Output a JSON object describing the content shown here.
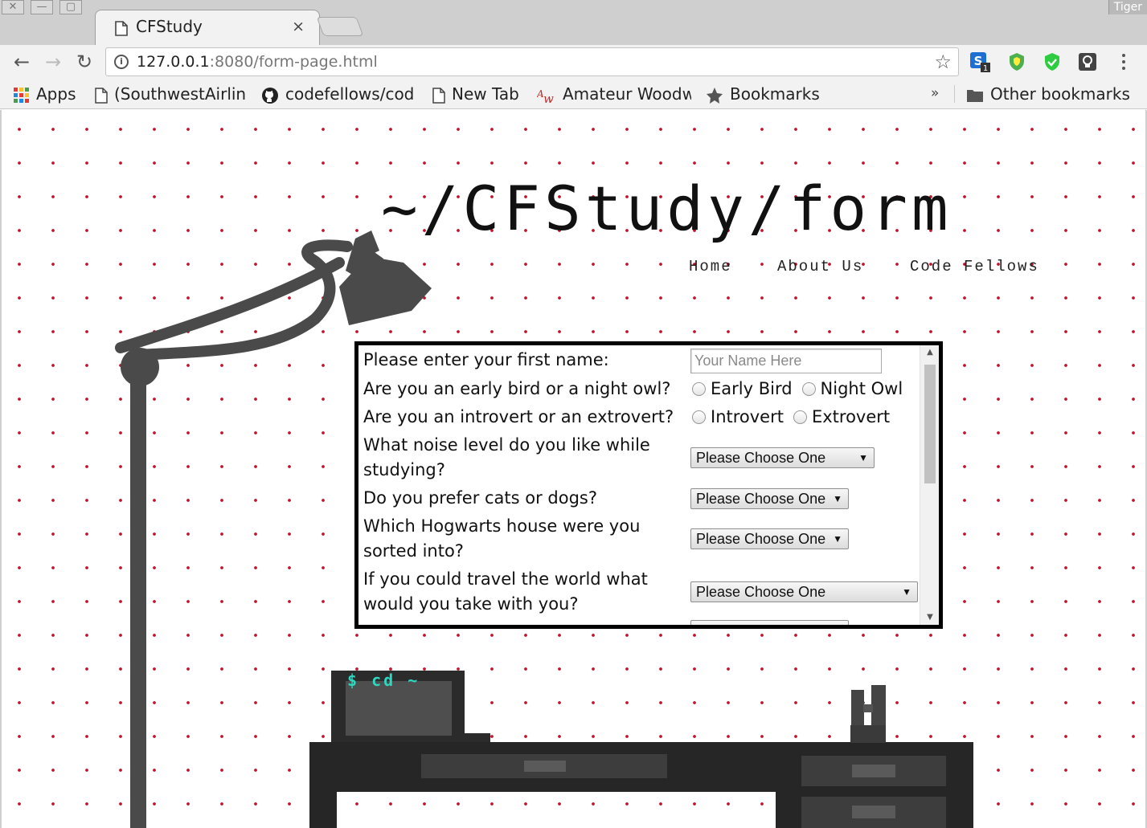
{
  "window": {
    "controls": [
      "✕",
      "—",
      "▢"
    ],
    "profile": "Tiger"
  },
  "tab": {
    "title": "CFStudy",
    "close": "×"
  },
  "toolbar": {
    "back": "←",
    "forward": "→",
    "reload": "↻",
    "url_host": "127.0.0.1",
    "url_rest": ":8080/form-page.html",
    "star": "☆",
    "ext_badge": "1"
  },
  "bookmarks": {
    "items": [
      "Apps",
      "(SouthwestAirlin",
      "codefellows/cod",
      "New Tab",
      "Amateur Woodw",
      "Bookmarks"
    ],
    "overflow": "»",
    "other": "Other bookmarks"
  },
  "page": {
    "title": "~/CFStudy/form",
    "nav": [
      "Home",
      "About Us",
      "Code Fellows"
    ],
    "terminal_text": "$ cd ~"
  },
  "form": {
    "name_label": "Please enter your first name:",
    "name_placeholder": "Your Name Here",
    "bird_label": "Are you an early bird or a night owl?",
    "bird_options": [
      "Early Bird",
      "Night Owl"
    ],
    "vert_label": "Are you an introvert or an extrovert?",
    "vert_options": [
      "Introvert",
      "Extrovert"
    ],
    "noise_label": "What noise level do you like while studying?",
    "pets_label": "Do you prefer cats or dogs?",
    "house_label": "Which Hogwarts house were you sorted into?",
    "travel_label": "If you could travel the world what would you take with you?",
    "select_default": "Please Choose One",
    "select_arrow": "▼",
    "scroll_up": "▲",
    "scroll_down": "▼"
  },
  "colors": {
    "dot": "#c2132a",
    "lamp": "#4a4a4a",
    "desk": "#262626",
    "terminal_text": "#2fd6c0"
  }
}
